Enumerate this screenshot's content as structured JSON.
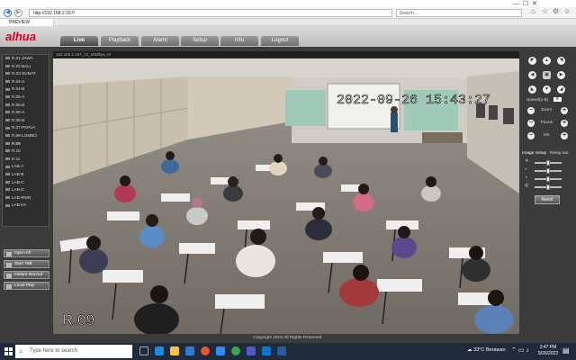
{
  "browser": {
    "url": "http://192.168.2.167/",
    "search_placeholder": "Search...",
    "tab_title": "PREVIEW",
    "icons": [
      "back-icon",
      "forward-icon",
      "home-icon",
      "star-icon",
      "gear-icon",
      "smiley-icon"
    ]
  },
  "app": {
    "logo": "alhua",
    "tabs": [
      {
        "label": "Live",
        "active": true
      },
      {
        "label": "Playback",
        "active": false
      },
      {
        "label": "Alarm",
        "active": false
      },
      {
        "label": "Setup",
        "active": false
      },
      {
        "label": "Info",
        "active": false
      },
      {
        "label": "Logout",
        "active": false
      }
    ],
    "channels": [
      "R.01-JAWA",
      "R.02-BALI",
      "R.03-SUMAT",
      "R.04-A",
      "R.04-B",
      "R.05-A",
      "R.05-B",
      "R.06-A",
      "R.06-B",
      "R.07-PAPUA",
      "R.08-LOMBO",
      "R.09",
      "R.10",
      "R.11",
      "LAB-A",
      "LAB-B",
      "LAB-C",
      "LAB-D",
      "LAB-IRSN",
      "LAB-KA"
    ],
    "selected_channel": "R.09",
    "left_buttons": [
      "Open All",
      "Start Talk",
      "Instant Record",
      "Local Play"
    ],
    "video": {
      "info_bar": "192.168.2.167_12_50Mbps_M",
      "timestamp": "2022-09-26 15:43:27",
      "channel_label": "R.09"
    },
    "ptz": {
      "speed_label": "Speed(1-8)",
      "speed_value": "5",
      "zoom_label": "Zoom",
      "focus_label": "Focus",
      "iris_label": "Iris",
      "image_setup": "Image Setup",
      "relay_out": "Relay-out",
      "reset_label": "Reset"
    },
    "footer": "Copyright 2015,All Rights Reserved."
  },
  "taskbar": {
    "search_placeholder": "Type here to search",
    "weather": "33°C  Berawan",
    "time": "3:47 PM",
    "date": "9/26/2022"
  },
  "colors": {
    "brand": "#d6001c",
    "app_bg": "#3b3b3b",
    "taskbar": "#1f2b3a"
  }
}
